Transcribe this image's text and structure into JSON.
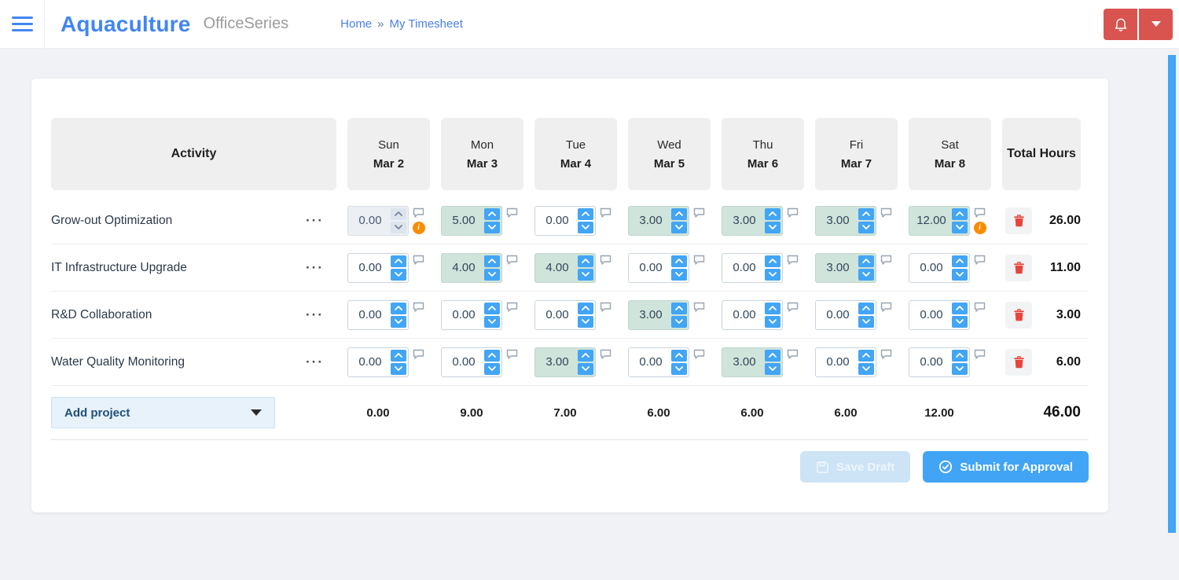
{
  "topbar": {
    "brand": "Aquaculture",
    "suite": "OfficeSeries",
    "breadcrumb": {
      "home": "Home",
      "separator": "»",
      "current": "My Timesheet"
    }
  },
  "icons": {
    "row_menu": "···",
    "warning": "i"
  },
  "colors": {
    "accent_blue": "#4285f4",
    "spinner_blue": "#42a5f5",
    "filled_cell_bg": "#cfe4da",
    "danger_red": "#d9534f",
    "trash_red": "#e8443c",
    "warning_orange": "#fb8c00",
    "submit_blue": "#41a4f5",
    "page_bg": "#f0f2f5"
  },
  "timesheet": {
    "activity_header": "Activity",
    "total_header": "Total Hours",
    "columns": [
      {
        "day": "Sun",
        "date": "Mar 2"
      },
      {
        "day": "Mon",
        "date": "Mar 3"
      },
      {
        "day": "Tue",
        "date": "Mar 4"
      },
      {
        "day": "Wed",
        "date": "Mar 5"
      },
      {
        "day": "Thu",
        "date": "Mar 6"
      },
      {
        "day": "Fri",
        "date": "Mar 7"
      },
      {
        "day": "Sat",
        "date": "Mar 8"
      }
    ],
    "rows": [
      {
        "activity": "Grow-out Optimization",
        "total": "26.00",
        "cells": [
          {
            "value": "0.00",
            "state": "disabled",
            "warning": true
          },
          {
            "value": "5.00",
            "state": "filled",
            "warning": false
          },
          {
            "value": "0.00",
            "state": "empty",
            "warning": false
          },
          {
            "value": "3.00",
            "state": "filled",
            "warning": false
          },
          {
            "value": "3.00",
            "state": "filled",
            "warning": false
          },
          {
            "value": "3.00",
            "state": "filled",
            "warning": false
          },
          {
            "value": "12.00",
            "state": "filled",
            "warning": true
          }
        ]
      },
      {
        "activity": "IT Infrastructure Upgrade",
        "total": "11.00",
        "cells": [
          {
            "value": "0.00",
            "state": "empty",
            "warning": false
          },
          {
            "value": "4.00",
            "state": "filled",
            "warning": false
          },
          {
            "value": "4.00",
            "state": "filled",
            "warning": false
          },
          {
            "value": "0.00",
            "state": "empty",
            "warning": false
          },
          {
            "value": "0.00",
            "state": "empty",
            "warning": false
          },
          {
            "value": "3.00",
            "state": "filled",
            "warning": false
          },
          {
            "value": "0.00",
            "state": "empty",
            "warning": false
          }
        ]
      },
      {
        "activity": "R&D Collaboration",
        "total": "3.00",
        "cells": [
          {
            "value": "0.00",
            "state": "empty",
            "warning": false
          },
          {
            "value": "0.00",
            "state": "empty",
            "warning": false
          },
          {
            "value": "0.00",
            "state": "empty",
            "warning": false
          },
          {
            "value": "3.00",
            "state": "filled",
            "warning": false
          },
          {
            "value": "0.00",
            "state": "empty",
            "warning": false
          },
          {
            "value": "0.00",
            "state": "empty",
            "warning": false
          },
          {
            "value": "0.00",
            "state": "empty",
            "warning": false
          }
        ]
      },
      {
        "activity": "Water Quality Monitoring",
        "total": "6.00",
        "cells": [
          {
            "value": "0.00",
            "state": "empty",
            "warning": false
          },
          {
            "value": "0.00",
            "state": "empty",
            "warning": false
          },
          {
            "value": "3.00",
            "state": "filled",
            "warning": false
          },
          {
            "value": "0.00",
            "state": "empty",
            "warning": false
          },
          {
            "value": "3.00",
            "state": "filled",
            "warning": false
          },
          {
            "value": "0.00",
            "state": "empty",
            "warning": false
          },
          {
            "value": "0.00",
            "state": "empty",
            "warning": false
          }
        ]
      }
    ],
    "footer": {
      "add_project_label": "Add project",
      "day_totals": [
        "0.00",
        "9.00",
        "7.00",
        "6.00",
        "6.00",
        "6.00",
        "12.00"
      ],
      "grand_total": "46.00"
    },
    "actions": {
      "save_draft_label": "Save Draft",
      "submit_label": "Submit for Approval"
    }
  }
}
